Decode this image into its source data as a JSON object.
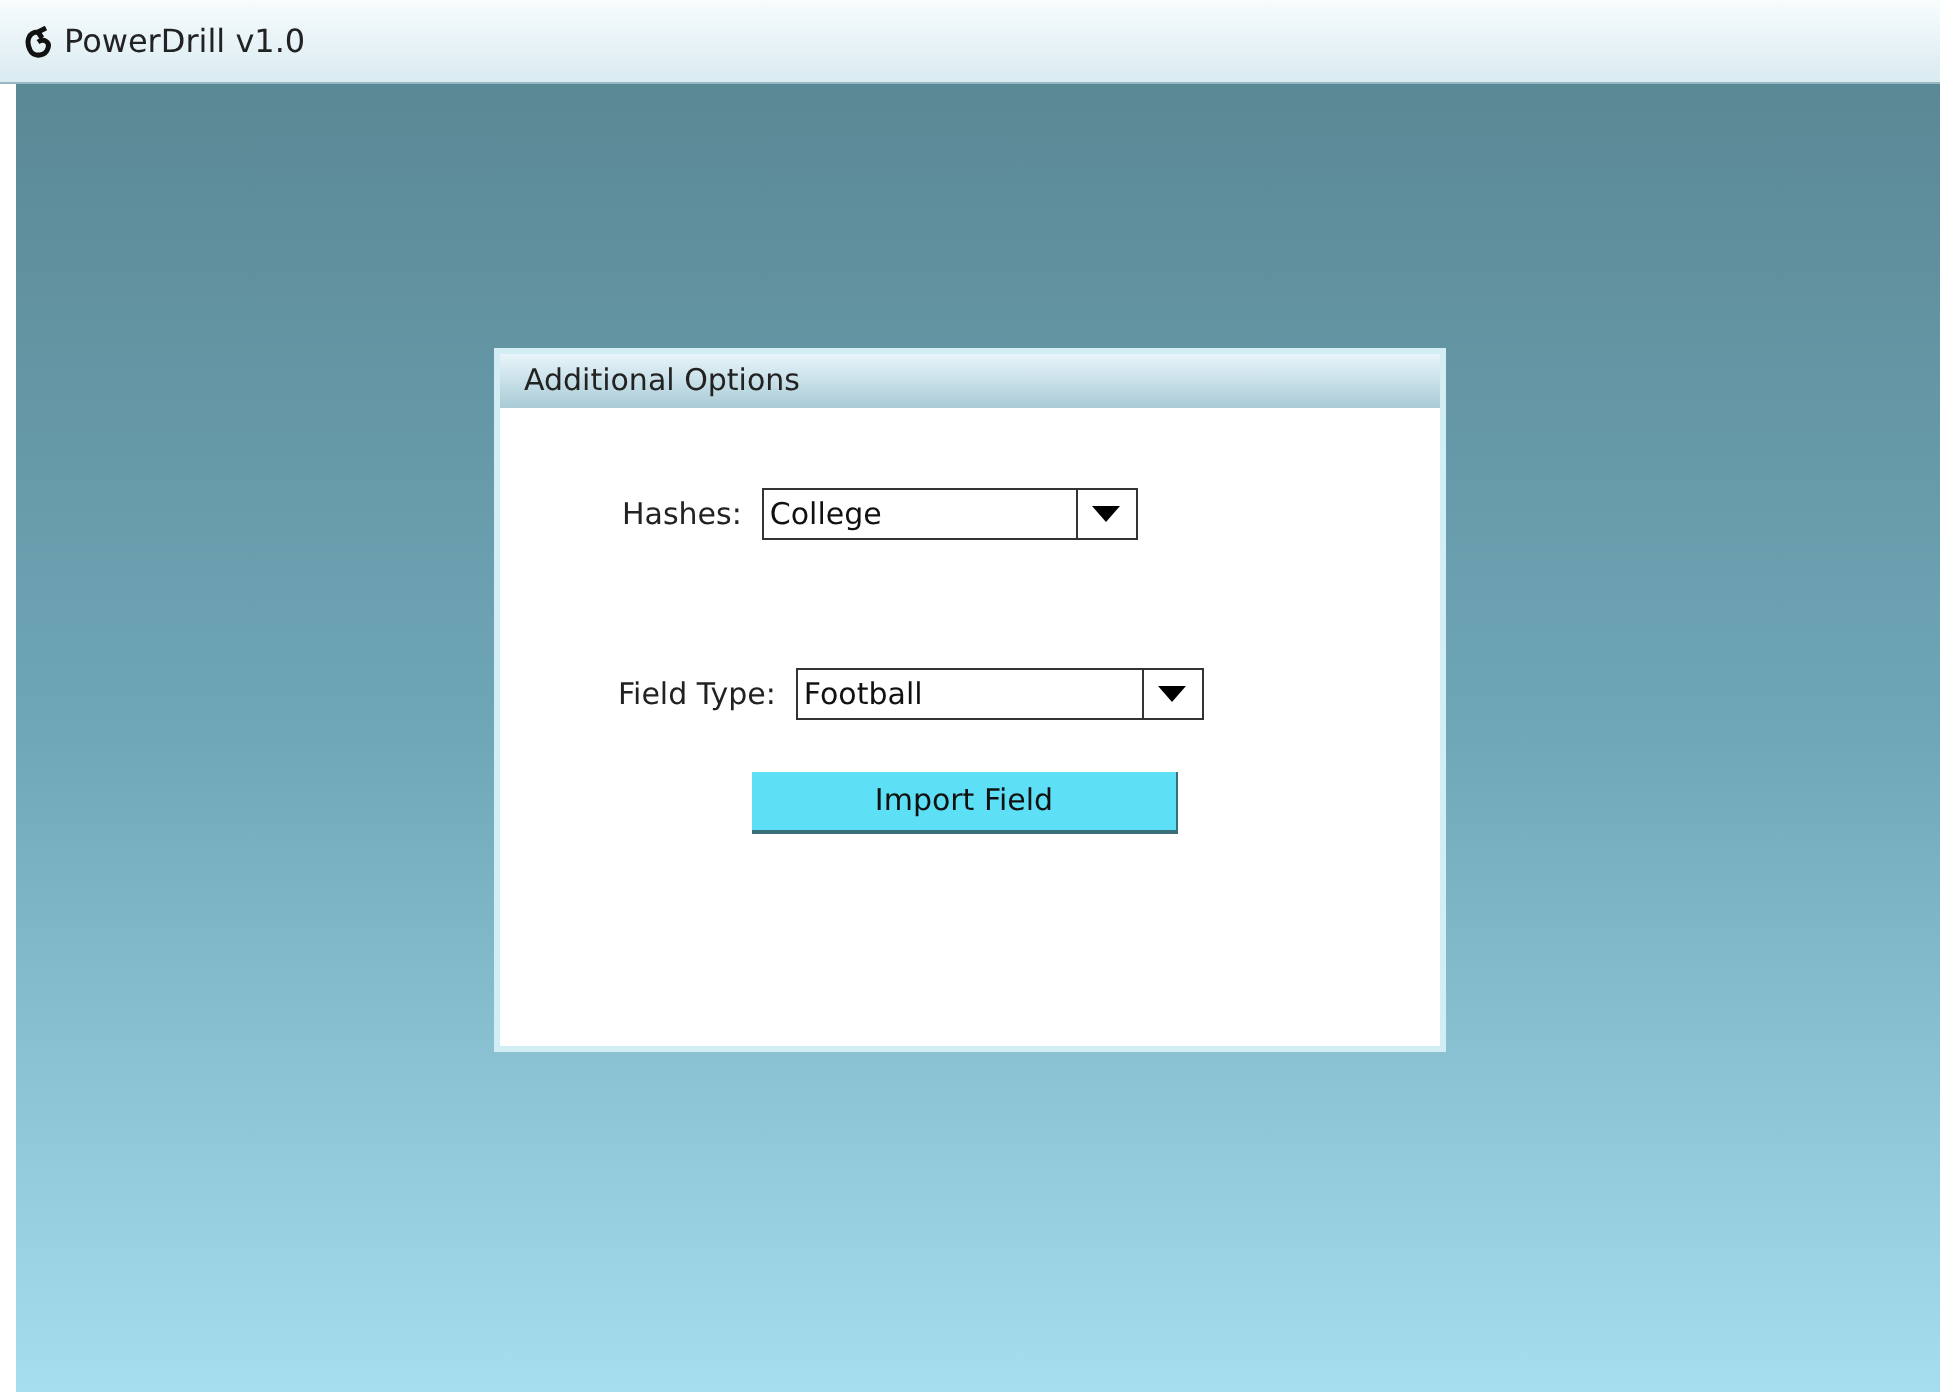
{
  "window": {
    "title": "PowerDrill v1.0"
  },
  "dialog": {
    "title": "Additional Options",
    "fields": [
      {
        "label": "Hashes:",
        "value": "College"
      },
      {
        "label": "Field Type:",
        "value": "Football"
      }
    ],
    "button": "Import Field"
  }
}
